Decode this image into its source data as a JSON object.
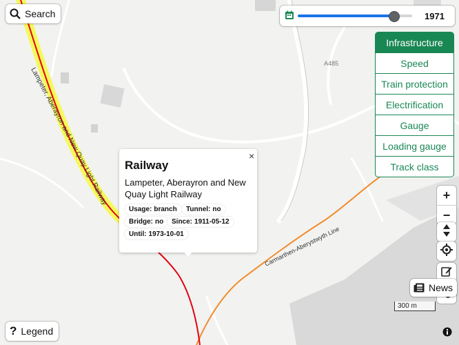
{
  "map": {
    "railway_label": "Lampeter, Aberayron and New Quay Light Railway",
    "line_label": "Carmarthen-Aberystwyth Line",
    "road_label": "A485",
    "colors": {
      "active_railway": "#e3000f",
      "main_line": "#f08b2a",
      "highlight": "#f6f85a",
      "background": "#f2f2f0"
    }
  },
  "search": {
    "label": "Search"
  },
  "legend": {
    "label": "Legend"
  },
  "date_slider": {
    "year": "1971",
    "value_fraction": 0.84
  },
  "layers": [
    {
      "label": "Infrastructure",
      "active": true
    },
    {
      "label": "Speed",
      "active": false
    },
    {
      "label": "Train protection",
      "active": false
    },
    {
      "label": "Electrification",
      "active": false
    },
    {
      "label": "Gauge",
      "active": false
    },
    {
      "label": "Loading gauge",
      "active": false
    },
    {
      "label": "Track class",
      "active": false
    }
  ],
  "zoom": {
    "in": "+",
    "out": "−"
  },
  "news": {
    "label": "News"
  },
  "scale": {
    "label": "300 m"
  },
  "popup": {
    "title": "Railway",
    "name": "Lampeter, Aberayron and New Quay Light Railway",
    "close": "×",
    "usage": {
      "label": "Usage:",
      "value": "branch"
    },
    "tunnel": {
      "label": "Tunnel:",
      "value": "no"
    },
    "bridge": {
      "label": "Bridge:",
      "value": "no"
    },
    "since": {
      "label": "Since:",
      "value": "1911-05-12"
    },
    "until": {
      "label": "Until:",
      "value": "1973-10-01"
    }
  }
}
